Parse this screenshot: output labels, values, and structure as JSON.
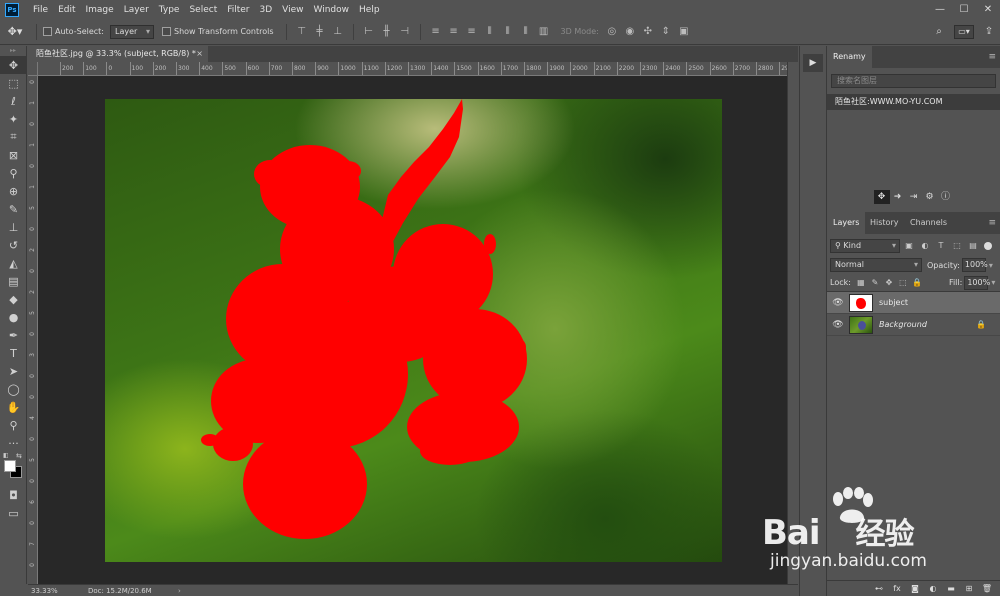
{
  "app": {
    "logo": "Ps"
  },
  "menu": [
    "File",
    "Edit",
    "Image",
    "Layer",
    "Type",
    "Select",
    "Filter",
    "3D",
    "View",
    "Window",
    "Help"
  ],
  "window_controls": {
    "minimize": "—",
    "maximize": "☐",
    "close": "✕"
  },
  "options_bar": {
    "auto_select_label": "Auto-Select:",
    "auto_select_value": "Layer",
    "show_transform_label": "Show Transform Controls",
    "mode_3d_label": "3D Mode:"
  },
  "document": {
    "tab_title": "陌鱼社区.jpg @ 33.3% (subject, RGB/8) *",
    "tab_close": "×"
  },
  "ruler": {
    "h_ticks": [
      "200",
      "100",
      "0",
      "100",
      "200",
      "300",
      "400",
      "500",
      "600",
      "700",
      "800",
      "900",
      "1000",
      "1100",
      "1200",
      "1300",
      "1400",
      "1500",
      "1600",
      "1700",
      "1800",
      "1900",
      "2000",
      "2100",
      "2200",
      "2300",
      "2400",
      "2500",
      "2600",
      "2700",
      "2800",
      "2900"
    ],
    "v_ticks": [
      "0",
      "1",
      "0",
      "1",
      "0",
      "1",
      "5",
      "0",
      "2",
      "0",
      "2",
      "5",
      "0",
      "3",
      "0",
      "0",
      "4",
      "0",
      "5",
      "0",
      "6",
      "0",
      "7",
      "0"
    ]
  },
  "status": {
    "zoom": "33.33%",
    "doc": "Doc: 15.2M/20.6M",
    "arrow": "›"
  },
  "panel_strip": {
    "play": "▶"
  },
  "renamy": {
    "tab": "Renamy",
    "menu": "≡",
    "search_placeholder": "搜索名图层",
    "item": "陌鱼社区:WWW.MO-YU.COM"
  },
  "layers_panel": {
    "tabs": [
      "Layers",
      "History",
      "Channels"
    ],
    "menu": "≡",
    "kind_label": "Kind",
    "blend_mode": "Normal",
    "opacity_label": "Opacity:",
    "opacity_value": "100%",
    "lock_label": "Lock:",
    "fill_label": "Fill:",
    "fill_value": "100%",
    "layers": [
      {
        "name": "subject",
        "selected": true
      },
      {
        "name": "Background",
        "selected": false
      }
    ],
    "footer_icons": [
      "link-icon",
      "fx-icon",
      "mask-icon",
      "adjustment-icon",
      "group-icon",
      "new-layer-icon",
      "trash-icon"
    ]
  },
  "watermark": {
    "brand": "Bai",
    "brand_cn": "经验",
    "url": "jingyan.baidu.com"
  },
  "colors": {
    "subject_fill": "#ff0000",
    "foreground": "#ffffff",
    "background": "#000000"
  }
}
